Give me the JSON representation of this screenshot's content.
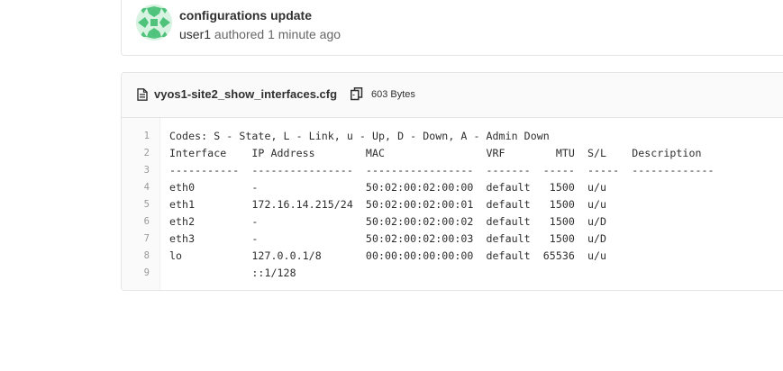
{
  "commit": {
    "title": "configurations update",
    "author": "user1",
    "meta_rest": " authored 1 minute ago"
  },
  "file": {
    "icon": "file-text-icon",
    "name": "vyos1-site2_show_interfaces.cfg",
    "copy_icon": "copy-icon",
    "size": "603 Bytes"
  },
  "code": {
    "line_numbers": [
      "1",
      "2",
      "3",
      "4",
      "5",
      "6",
      "7",
      "8",
      "9"
    ],
    "lines": [
      "Codes: S - State, L - Link, u - Up, D - Down, A - Admin Down",
      "Interface    IP Address        MAC                VRF        MTU  S/L    Description",
      "-----------  ----------------  -----------------  -------  -----  -----  -------------",
      "eth0         -                 50:02:00:02:00:00  default   1500  u/u",
      "eth1         172.16.14.215/24  50:02:00:02:00:01  default   1500  u/u",
      "eth2         -                 50:02:00:02:00:02  default   1500  u/D",
      "eth3         -                 50:02:00:02:00:03  default   1500  u/D",
      "lo           127.0.0.1/8       00:00:00:00:00:00  default  65536  u/u",
      "             ::1/128"
    ]
  },
  "colors": {
    "avatar_green": "#4fc27b",
    "border": "#e5e5e5",
    "header_bg": "#fafafa"
  }
}
